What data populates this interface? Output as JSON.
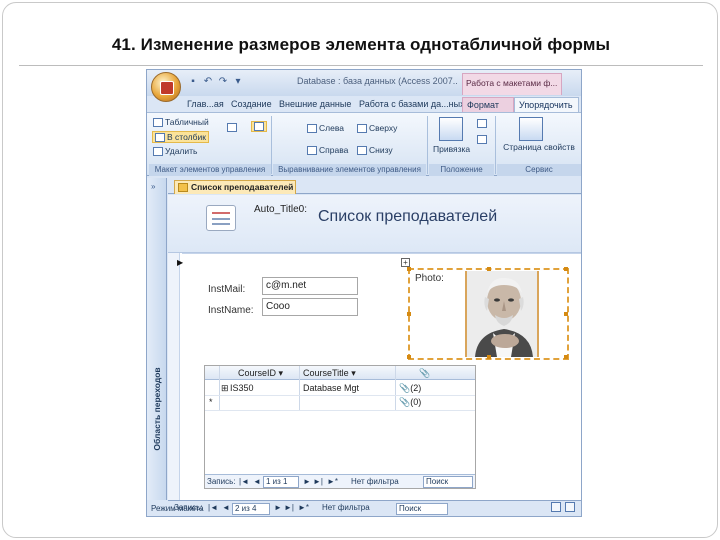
{
  "slide": {
    "title": "41. Изменение размеров элемента однотабличной формы"
  },
  "window": {
    "title": "Database : база данных (Access 2007... - Mic...",
    "context_tab": "Работа с макетами ф..."
  },
  "ribbon_tabs": [
    {
      "label": "Глав...ая"
    },
    {
      "label": "Создание"
    },
    {
      "label": "Внешние данные"
    },
    {
      "label": "Работа с базами да...ных"
    },
    {
      "label": "Формат"
    },
    {
      "label": "Упорядочить"
    }
  ],
  "ribbon": {
    "tabular": "Табличный",
    "stacked": "В столбик",
    "remove": "Удалить",
    "left": "Слева",
    "top": "Сверху",
    "right": "Справа",
    "bottom": "Снизу",
    "anchor": "Привязка",
    "property_sheet": "Страница свойств",
    "groups": {
      "layout": "Макет элементов управления",
      "alignment": "Выравнивание элементов управления",
      "position": "Положение",
      "tools": "Сервис"
    }
  },
  "nav_pane": {
    "label": "Область переходов",
    "chevron": "»"
  },
  "document_tab": {
    "label": "Список преподавателей"
  },
  "form": {
    "auto_title_label": "Auto_Title0:",
    "title": "Список преподавателей",
    "record_arrow": "▶",
    "inst_mail_label": "InstMail:",
    "inst_mail_value": "c@m.net",
    "inst_name_label": "InstName:",
    "inst_name_value": "Cooo",
    "photo_label": "Photo:",
    "move_handle": "+"
  },
  "subform": {
    "columns": [
      "CourseID",
      "CourseTitle",
      "📎"
    ],
    "sort_glyph": "▾",
    "rows": [
      {
        "selector": "",
        "expand": "⊞",
        "course_id": "IS350",
        "course_title": "Database Mgt",
        "attachments": "(2)"
      },
      {
        "selector": "*",
        "expand": "",
        "course_id": "",
        "course_title": "",
        "attachments": "(0)"
      }
    ],
    "nav": {
      "record_label": "Запись:",
      "position": "1 из 1",
      "filter": "Нет фильтра",
      "search": "Поиск"
    }
  },
  "main_nav": {
    "record_label": "Запись:",
    "position": "2 из 4",
    "filter": "Нет фильтра",
    "search": "Поиск"
  },
  "status": {
    "text": "Режим макета"
  },
  "nav_glyphs": {
    "first": "|◄",
    "prev": "◄",
    "next": "►",
    "last": "►|",
    "new": "►*"
  },
  "colors": {
    "accent_selection": "#e1a23b",
    "ribbon_blue": "#dbe6f5",
    "context_pink": "#f2d9e6"
  }
}
